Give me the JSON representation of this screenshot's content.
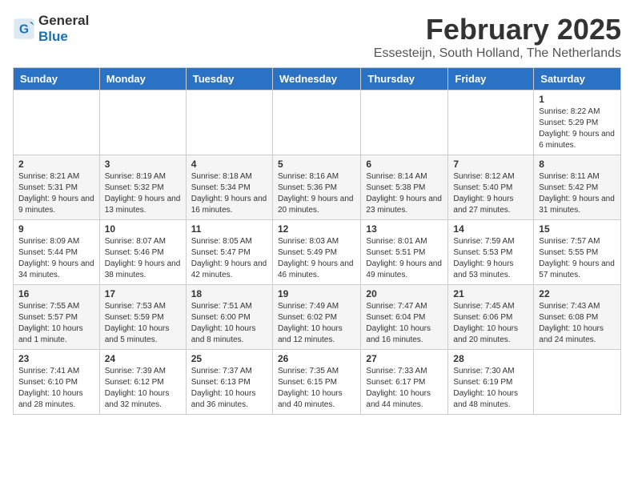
{
  "header": {
    "logo_general": "General",
    "logo_blue": "Blue",
    "title": "February 2025",
    "subtitle": "Essesteijn, South Holland, The Netherlands"
  },
  "weekdays": [
    "Sunday",
    "Monday",
    "Tuesday",
    "Wednesday",
    "Thursday",
    "Friday",
    "Saturday"
  ],
  "weeks": [
    [
      {
        "date": "",
        "info": ""
      },
      {
        "date": "",
        "info": ""
      },
      {
        "date": "",
        "info": ""
      },
      {
        "date": "",
        "info": ""
      },
      {
        "date": "",
        "info": ""
      },
      {
        "date": "",
        "info": ""
      },
      {
        "date": "1",
        "info": "Sunrise: 8:22 AM\nSunset: 5:29 PM\nDaylight: 9 hours and 6 minutes."
      }
    ],
    [
      {
        "date": "2",
        "info": "Sunrise: 8:21 AM\nSunset: 5:31 PM\nDaylight: 9 hours and 9 minutes."
      },
      {
        "date": "3",
        "info": "Sunrise: 8:19 AM\nSunset: 5:32 PM\nDaylight: 9 hours and 13 minutes."
      },
      {
        "date": "4",
        "info": "Sunrise: 8:18 AM\nSunset: 5:34 PM\nDaylight: 9 hours and 16 minutes."
      },
      {
        "date": "5",
        "info": "Sunrise: 8:16 AM\nSunset: 5:36 PM\nDaylight: 9 hours and 20 minutes."
      },
      {
        "date": "6",
        "info": "Sunrise: 8:14 AM\nSunset: 5:38 PM\nDaylight: 9 hours and 23 minutes."
      },
      {
        "date": "7",
        "info": "Sunrise: 8:12 AM\nSunset: 5:40 PM\nDaylight: 9 hours and 27 minutes."
      },
      {
        "date": "8",
        "info": "Sunrise: 8:11 AM\nSunset: 5:42 PM\nDaylight: 9 hours and 31 minutes."
      }
    ],
    [
      {
        "date": "9",
        "info": "Sunrise: 8:09 AM\nSunset: 5:44 PM\nDaylight: 9 hours and 34 minutes."
      },
      {
        "date": "10",
        "info": "Sunrise: 8:07 AM\nSunset: 5:46 PM\nDaylight: 9 hours and 38 minutes."
      },
      {
        "date": "11",
        "info": "Sunrise: 8:05 AM\nSunset: 5:47 PM\nDaylight: 9 hours and 42 minutes."
      },
      {
        "date": "12",
        "info": "Sunrise: 8:03 AM\nSunset: 5:49 PM\nDaylight: 9 hours and 46 minutes."
      },
      {
        "date": "13",
        "info": "Sunrise: 8:01 AM\nSunset: 5:51 PM\nDaylight: 9 hours and 49 minutes."
      },
      {
        "date": "14",
        "info": "Sunrise: 7:59 AM\nSunset: 5:53 PM\nDaylight: 9 hours and 53 minutes."
      },
      {
        "date": "15",
        "info": "Sunrise: 7:57 AM\nSunset: 5:55 PM\nDaylight: 9 hours and 57 minutes."
      }
    ],
    [
      {
        "date": "16",
        "info": "Sunrise: 7:55 AM\nSunset: 5:57 PM\nDaylight: 10 hours and 1 minute."
      },
      {
        "date": "17",
        "info": "Sunrise: 7:53 AM\nSunset: 5:59 PM\nDaylight: 10 hours and 5 minutes."
      },
      {
        "date": "18",
        "info": "Sunrise: 7:51 AM\nSunset: 6:00 PM\nDaylight: 10 hours and 8 minutes."
      },
      {
        "date": "19",
        "info": "Sunrise: 7:49 AM\nSunset: 6:02 PM\nDaylight: 10 hours and 12 minutes."
      },
      {
        "date": "20",
        "info": "Sunrise: 7:47 AM\nSunset: 6:04 PM\nDaylight: 10 hours and 16 minutes."
      },
      {
        "date": "21",
        "info": "Sunrise: 7:45 AM\nSunset: 6:06 PM\nDaylight: 10 hours and 20 minutes."
      },
      {
        "date": "22",
        "info": "Sunrise: 7:43 AM\nSunset: 6:08 PM\nDaylight: 10 hours and 24 minutes."
      }
    ],
    [
      {
        "date": "23",
        "info": "Sunrise: 7:41 AM\nSunset: 6:10 PM\nDaylight: 10 hours and 28 minutes."
      },
      {
        "date": "24",
        "info": "Sunrise: 7:39 AM\nSunset: 6:12 PM\nDaylight: 10 hours and 32 minutes."
      },
      {
        "date": "25",
        "info": "Sunrise: 7:37 AM\nSunset: 6:13 PM\nDaylight: 10 hours and 36 minutes."
      },
      {
        "date": "26",
        "info": "Sunrise: 7:35 AM\nSunset: 6:15 PM\nDaylight: 10 hours and 40 minutes."
      },
      {
        "date": "27",
        "info": "Sunrise: 7:33 AM\nSunset: 6:17 PM\nDaylight: 10 hours and 44 minutes."
      },
      {
        "date": "28",
        "info": "Sunrise: 7:30 AM\nSunset: 6:19 PM\nDaylight: 10 hours and 48 minutes."
      },
      {
        "date": "",
        "info": ""
      }
    ]
  ]
}
